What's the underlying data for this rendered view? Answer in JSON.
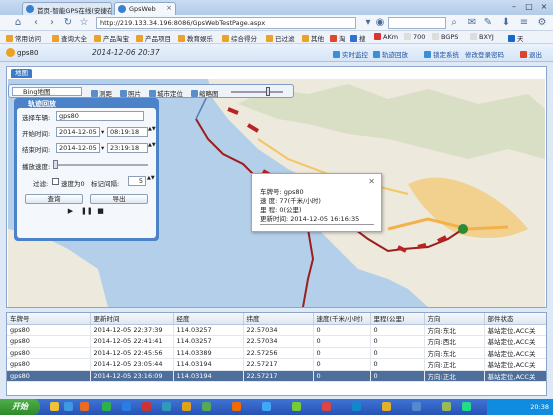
{
  "browser": {
    "tabs": [
      {
        "label": "首页-智能GPS在线(安捷在",
        "active": false
      },
      {
        "label": "GpsWeb",
        "active": true
      }
    ],
    "url": "http://219.133.34.196:8086/GpsWebTestPage.aspx",
    "favorites": [
      "常用访问",
      "查询大全",
      "产品淘宝",
      "产品项目",
      "教育娱乐",
      "综合得分",
      "已过滤",
      "其他",
      "淘",
      "搜",
      "AKm",
      "700",
      "BGPS",
      "BXYJ",
      "天"
    ]
  },
  "app": {
    "username": "gps80",
    "datetime": "2014-12-06 20:37",
    "links": [
      "实时监控",
      "轨迹回放",
      "锁定系统",
      "修改登录密码",
      "退出"
    ]
  },
  "map": {
    "tab_label": "地图",
    "toolbar": {
      "map_type": "Bing地图",
      "tools": [
        "测距",
        "照片",
        "城市定位",
        "缩略图"
      ]
    }
  },
  "panel": {
    "title": "轨迹回放",
    "plate_label": "选择车辆:",
    "plate_value": "gps80",
    "start_label": "开始时间:",
    "start_date": "2014-12-05",
    "start_time": "08:19:18",
    "end_label": "结束时间:",
    "end_date": "2014-12-05",
    "end_time": "23:19:18",
    "speed_label": "播放速度:",
    "filter_label": "过滤:",
    "speed0_label": "速度为0",
    "interval_label": "标记间隔:",
    "interval_value": "5",
    "query_button": "查询",
    "export_button": "导出"
  },
  "popup": {
    "plate": "车牌号: gps80",
    "speed": "速   度: 77(千米/小时)",
    "mileage": "里   程: 0(公里)",
    "updated": "更新时间: 2014-12-05 16:16:35"
  },
  "table": {
    "columns": [
      "车牌号",
      "更新时间",
      "经度",
      "纬度",
      "速度(千米/小时)",
      "里程(公里)",
      "方向",
      "部件状态"
    ],
    "rows": [
      [
        "gps80",
        "2014-12-05 22:37:39",
        "114.03257",
        "22.57034",
        "0",
        "0",
        "方向:东北",
        "基站定位,ACC关"
      ],
      [
        "gps80",
        "2014-12-05 22:41:41",
        "114.03257",
        "22.57034",
        "0",
        "0",
        "方向:西北",
        "基站定位,ACC关"
      ],
      [
        "gps80",
        "2014-12-05 22:45:56",
        "114.03389",
        "22.57256",
        "0",
        "0",
        "方向:东北",
        "基站定位,ACC关"
      ],
      [
        "gps80",
        "2014-12-05 23:05:44",
        "114.03194",
        "22.57217",
        "0",
        "0",
        "方向:正北",
        "基站定位,ACC关"
      ],
      [
        "gps80",
        "2014-12-05 23:16:09",
        "114.03194",
        "22.57217",
        "0",
        "0",
        "方向:正北",
        "基站定位,ACC关"
      ]
    ],
    "selected_row": 4
  },
  "taskbar": {
    "start": "开始",
    "time": "20:38"
  }
}
